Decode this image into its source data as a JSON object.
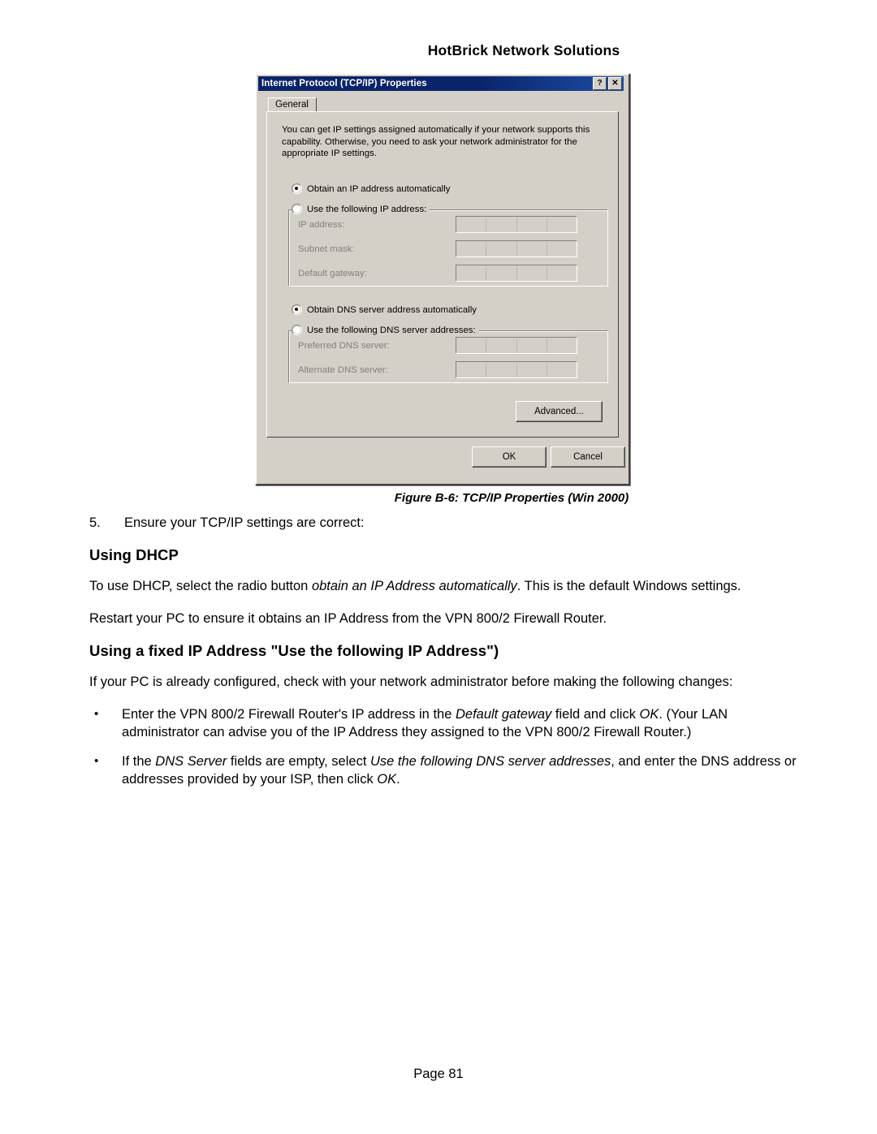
{
  "header": {
    "title": "HotBrick Network Solutions"
  },
  "dialog": {
    "title": "Internet Protocol (TCP/IP) Properties",
    "help_button": "?",
    "close_button": "✕",
    "tab": "General",
    "description": "You can get IP settings assigned automatically if your network supports this capability. Otherwise, you need to ask your network administrator for the appropriate IP settings.",
    "radio_obtain_ip": "Obtain an IP address automatically",
    "radio_use_ip": "Use the following IP address:",
    "label_ip_address": "IP address:",
    "label_subnet_mask": "Subnet mask:",
    "label_default_gateway": "Default gateway:",
    "radio_obtain_dns": "Obtain DNS server address automatically",
    "radio_use_dns": "Use the following DNS server addresses:",
    "label_preferred_dns": "Preferred DNS server:",
    "label_alternate_dns": "Alternate DNS server:",
    "ip_value": ".    .    .",
    "button_advanced": "Advanced...",
    "button_ok": "OK",
    "button_cancel": "Cancel"
  },
  "caption": "Figure B-6: TCP/IP Properties (Win 2000)",
  "body": {
    "step_number": "5.",
    "step_text": "Ensure your TCP/IP settings are correct:",
    "heading_dhcp": "Using DHCP",
    "para_dhcp_1_a": "To use DHCP, select the radio button ",
    "para_dhcp_1_em": "obtain an IP Address automatically",
    "para_dhcp_1_b": ". This is the default Windows settings.",
    "para_dhcp_2": "Restart your PC to ensure it obtains an IP Address from the VPN 800/2 Firewall Router.",
    "heading_fixed": "Using a fixed IP Address \"Use the following IP Address\")",
    "para_fixed_1": "If your PC is already configured, check with your network administrator before making the following changes:",
    "bullet_marker": "•",
    "bullet_1_a": "Enter the VPN 800/2 Firewall Router's IP address in the ",
    "bullet_1_em1": "Default gateway",
    "bullet_1_b": " field and click ",
    "bullet_1_em2": "OK",
    "bullet_1_c": ". (Your LAN administrator can advise you of the IP Address they assigned to the VPN 800/2 Firewall Router.)",
    "bullet_2_a": "If the ",
    "bullet_2_em1": "DNS Server",
    "bullet_2_b": " fields are empty, select ",
    "bullet_2_em2": "Use the following DNS server addresses",
    "bullet_2_c": ", and enter the DNS address or addresses provided by your ISP, then click ",
    "bullet_2_em3": "OK",
    "bullet_2_d": "."
  },
  "footer": {
    "page": "Page 81"
  }
}
